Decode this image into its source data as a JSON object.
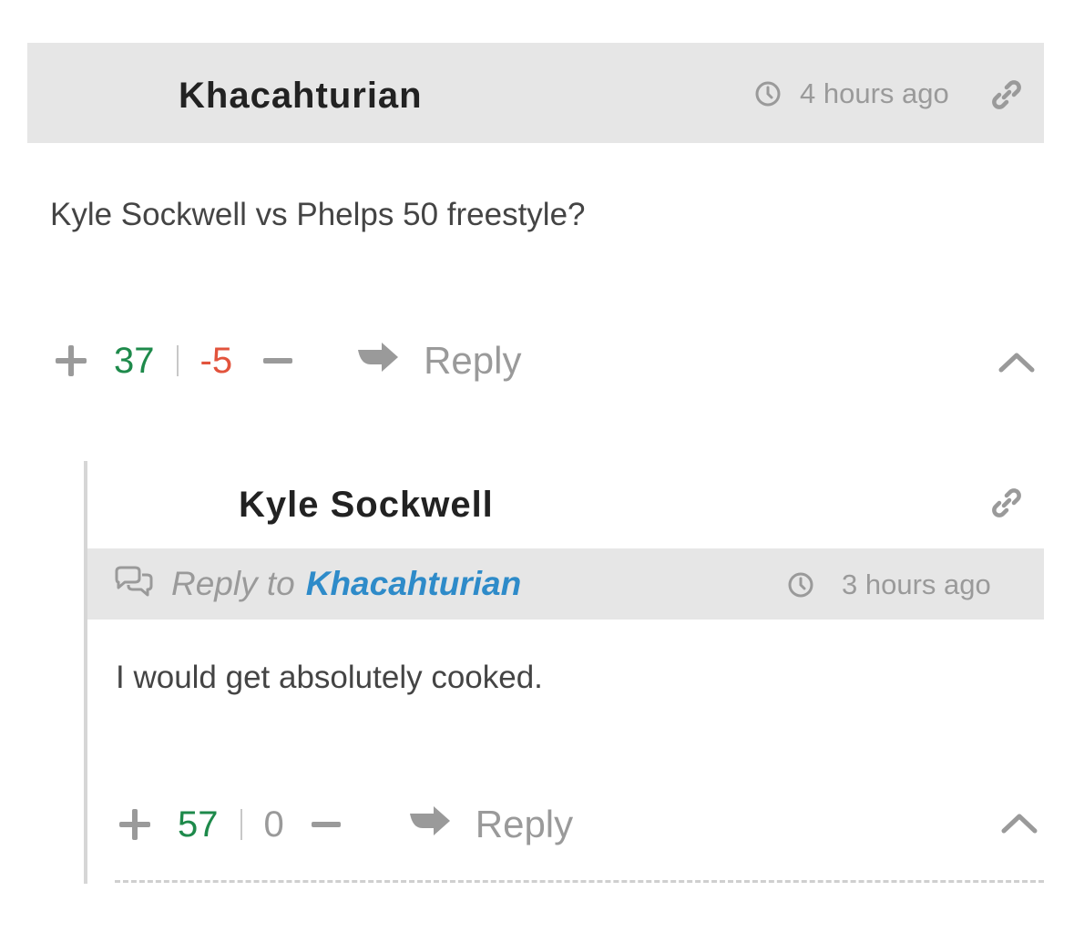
{
  "comment": {
    "author": "Khacahturian",
    "time": "4 hours ago",
    "body": "Kyle Sockwell vs Phelps 50 freestyle?",
    "upvotes": "37",
    "downvotes": "-5",
    "reply_label": "Reply"
  },
  "reply": {
    "author": "Kyle Sockwell",
    "reply_to_label": "Reply to",
    "reply_to_name": "Khacahturian",
    "time": "3 hours ago",
    "body": "I would get absolutely cooked.",
    "upvotes": "57",
    "downvotes": "0",
    "reply_label": "Reply"
  },
  "colors": {
    "upvote": "#1e8a4b",
    "downvote": "#e2533c",
    "link": "#2e8bc9",
    "header_bg": "#e6e6e6",
    "muted": "#9a9a9a"
  },
  "icons": [
    "clock-icon",
    "link-icon",
    "reply-arrow-icon",
    "chevron-up-icon",
    "speech-bubbles-icon"
  ]
}
